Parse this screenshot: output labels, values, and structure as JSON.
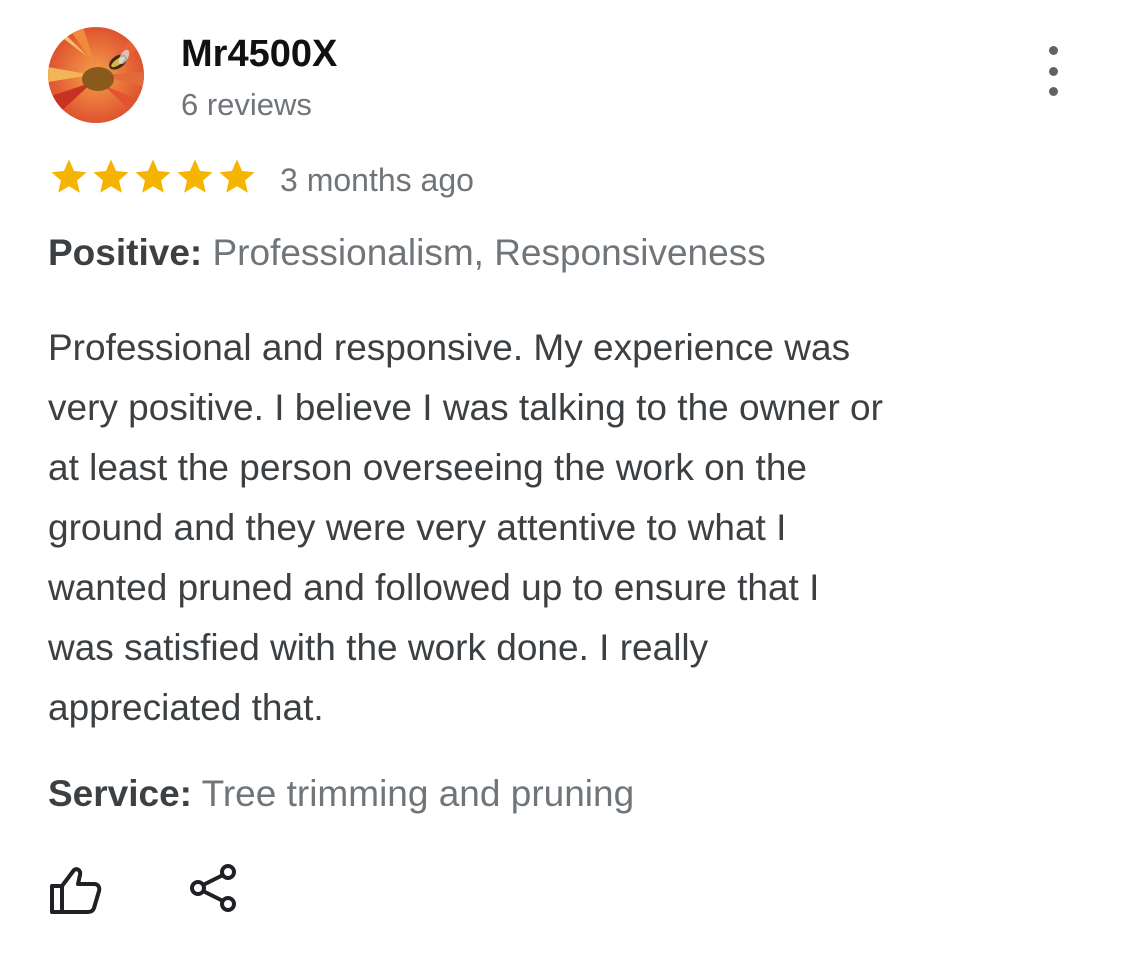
{
  "review": {
    "author": {
      "name": "Mr4500X",
      "reviews_count": "6 reviews"
    },
    "rating": 5,
    "rating_max": 5,
    "date": "3 months ago",
    "positive": {
      "label": "Positive:",
      "value": "Professionalism, Responsiveness"
    },
    "body_lines": [
      "Professional and responsive. My experience was",
      "very positive. I believe I was talking to the owner or",
      "at least the person overseeing the work on the",
      "ground and they were very attentive to what I",
      "wanted pruned and followed up to ensure that I",
      "was satisfied with the work done. I really",
      "appreciated that."
    ],
    "service": {
      "label": "Service:",
      "value": "Tree trimming and pruning"
    }
  },
  "icons": {
    "more": "more-vert-icon",
    "like": "thumbs-up-icon",
    "share": "share-icon",
    "star": "star-icon"
  },
  "colors": {
    "star": "#f4b400",
    "primary_text": "#3c4043",
    "secondary_text": "#70757a",
    "name_text": "#111111"
  }
}
